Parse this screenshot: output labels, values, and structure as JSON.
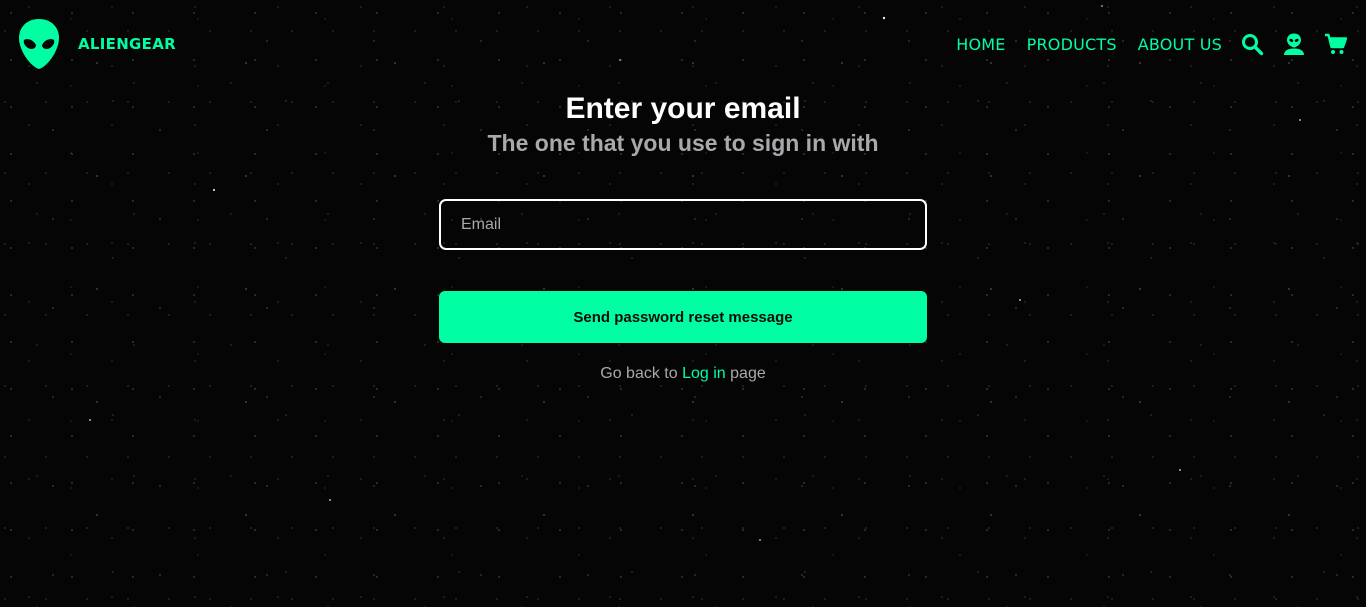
{
  "brand": {
    "name": "ALIENGEAR",
    "logo_icon": "alien-head-icon"
  },
  "nav": {
    "links": [
      "HOME",
      "PRODUCTS",
      "ABOUT US"
    ],
    "icons": [
      "search-icon",
      "alien-user-icon",
      "cart-icon"
    ]
  },
  "form": {
    "title": "Enter your email",
    "subtitle": "The one that you use to sign in with",
    "email_placeholder": "Email",
    "email_value": "",
    "submit_label": "Send password reset message",
    "back_prefix": "Go back to",
    "back_link_label": "Log in",
    "back_suffix": "page"
  },
  "colors": {
    "accent": "#00ffa3",
    "background": "#050506",
    "muted_text": "#a9a9ad",
    "title_text": "#ffffff"
  }
}
